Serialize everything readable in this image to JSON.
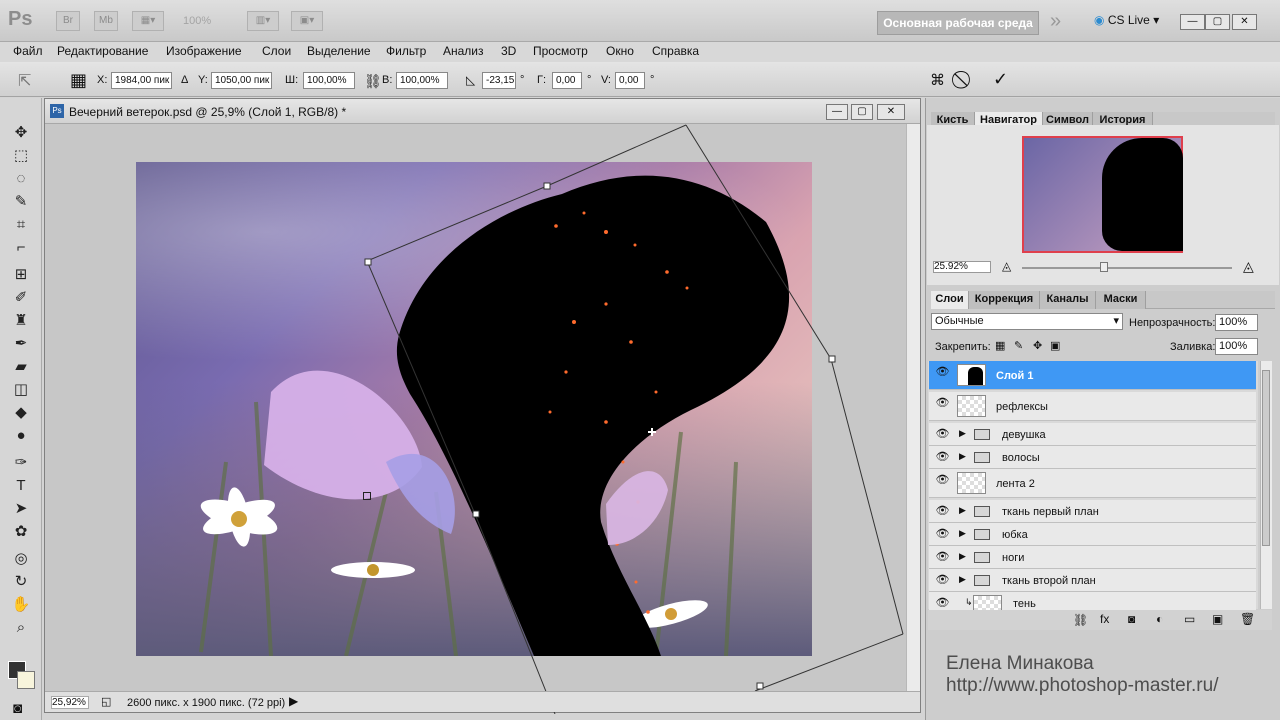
{
  "app": {
    "logo": "Ps",
    "logo_icons": [
      "Br",
      "Mb"
    ],
    "zoom_placeholder": "100%",
    "workspace": "Основная рабочая среда",
    "cs_live": "CS Live",
    "chevrons": "»"
  },
  "menu": [
    "Файл",
    "Редактирование",
    "Изображение",
    "Слои",
    "Выделение",
    "Фильтр",
    "Анализ",
    "3D",
    "Просмотр",
    "Окно",
    "Справка"
  ],
  "options": {
    "x_label": "X:",
    "x_value": "1984,00 пик",
    "delta": "Δ",
    "y_label": "Y:",
    "y_value": "1050,00 пик",
    "w_label": "Ш:",
    "w_value": "100,00%",
    "h_label": "В:",
    "h_value": "100,00%",
    "angle": "-23,15",
    "angle_unit": "°",
    "hskew_label": "Г:",
    "hskew_value": "0,00",
    "vskew_label": "V:",
    "vskew_value": "0,00",
    "degree": "°",
    "cancel": "⃠",
    "confirm": "✓"
  },
  "document": {
    "title": "Вечерний ветерок.psd @ 25,9% (Слой 1, RGB/8) *",
    "zoom": "25,92%",
    "size": "2600 пикс. x 1900 пикс. (72 ppi)"
  },
  "panels": {
    "top_tabs": [
      "Кисть",
      "Навигатор",
      "Символ",
      "История"
    ],
    "nav_zoom": "25.92%",
    "layer_tabs": [
      "Слои",
      "Коррекция",
      "Каналы",
      "Маски"
    ],
    "blend_mode": "Обычные",
    "opacity_label": "Непрозрачность:",
    "opacity": "100%",
    "lock_label": "Закрепить:",
    "fill_label": "Заливка:",
    "fill": "100%"
  },
  "layers": [
    {
      "name": "Слой 1",
      "type": "layer",
      "active": true
    },
    {
      "name": "рефлексы",
      "type": "layer",
      "active": false
    },
    {
      "name": "девушка",
      "type": "group",
      "active": false
    },
    {
      "name": "волосы",
      "type": "group",
      "active": false
    },
    {
      "name": "лента 2",
      "type": "layer",
      "active": false
    },
    {
      "name": "ткань первый план",
      "type": "group",
      "active": false
    },
    {
      "name": "юбка",
      "type": "group",
      "active": false
    },
    {
      "name": "ноги",
      "type": "group",
      "active": false
    },
    {
      "name": "ткань второй план",
      "type": "group",
      "active": false
    },
    {
      "name": "тень",
      "type": "layer",
      "active": false
    }
  ],
  "watermark": {
    "author": "Елена Минакова",
    "url": "http://www.photoshop-master.ru/"
  }
}
